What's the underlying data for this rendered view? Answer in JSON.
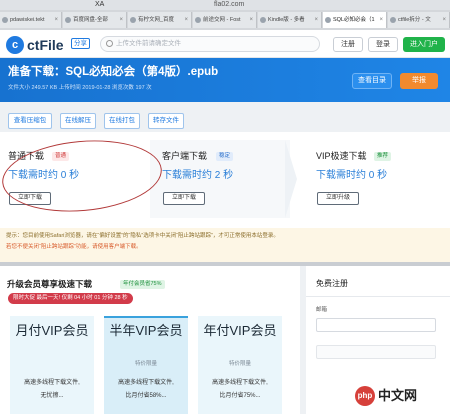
{
  "browser": {
    "address_text": "XA",
    "url": "fla02.com",
    "tabs": [
      {
        "label": "pdawiskei.tekt"
      },
      {
        "label": "百度网盘-全部"
      },
      {
        "label": "有柠文网_百度"
      },
      {
        "label": "前途交网 - Fost"
      },
      {
        "label": "Kindle版 - 多看"
      },
      {
        "label": "SQL必知必会（1"
      },
      {
        "label": "ctfile拆分 - 文"
      }
    ]
  },
  "header": {
    "logo_mark": "c",
    "logo_text": "ctFile",
    "logo_sub": "分享",
    "search_placeholder": "上传文件前请确定文件",
    "login": "注册",
    "register": "登录",
    "portal": "进入门户"
  },
  "banner": {
    "title": "准备下载：SQL必知必会（第4版）.epub",
    "meta": "文件大小 249.57 KB  上传时间 2019-01-28  浏览次数 197 次",
    "view_report": "查看目录",
    "report": "举报"
  },
  "actions": [
    "查看压缩包",
    "在线解压",
    "在线打包",
    "转存文件"
  ],
  "download": [
    {
      "name": "普通下载",
      "badge": "普通",
      "time": "下载需时约 0 秒",
      "button": "立即下载"
    },
    {
      "name": "客户端下载",
      "badge": "稳定",
      "time": "下载需时约 2 秒",
      "button": "立即下载"
    },
    {
      "name": "VIP极速下载",
      "badge": "推荐",
      "time": "下载需时约 0 秒",
      "button": "立即升级"
    }
  ],
  "notice": {
    "line1": "提示：您目前使用Safari浏览器，请在“偏好设置”的“隐私”选项卡中关闭“阻止跨站跟踪”，才可正常使用本站登录。",
    "line2": "若您不便关闭“阻止跨站跟踪”功能，请使用客户端下载。"
  },
  "vip": {
    "heading": "升级会员尊享极速下载",
    "tag": "年付会员省75%",
    "promo": "限时大促 最后一天! 仅剩 04 小时 01 分钟 28 秒",
    "cards": [
      {
        "title": "月付VIP会员",
        "sub": "",
        "desc1": "高速多线程下载文件,",
        "desc2": "无忧擦..."
      },
      {
        "title": "半年VIP会员",
        "sub": "特价限量",
        "desc1": "高速多线程下载文件,",
        "desc2": "比月付省58%..."
      },
      {
        "title": "年付VIP会员",
        "sub": "特价限量",
        "desc1": "高速多线程下载文件,",
        "desc2": "比月付省75%..."
      }
    ]
  },
  "register": {
    "title": "免费注册",
    "label": "邮箱"
  },
  "watermark": {
    "mark": "php",
    "text": "中文网"
  }
}
